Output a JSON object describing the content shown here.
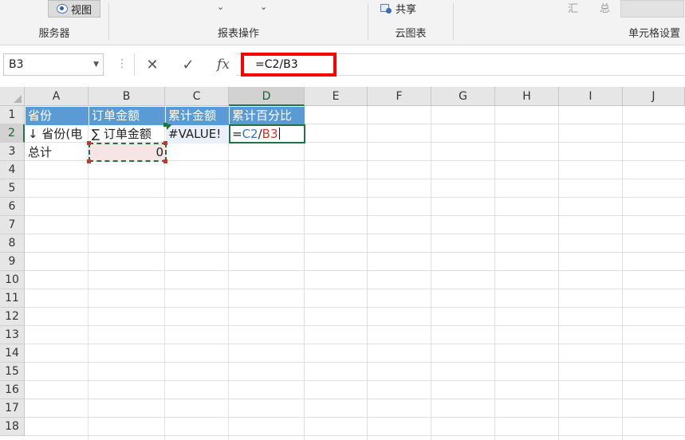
{
  "ribbon": {
    "view_button": "视图",
    "groups": [
      {
        "label": "服务器"
      },
      {
        "label": "报表操作"
      },
      {
        "label": "云图表"
      },
      {
        "label": "单元格设置"
      }
    ],
    "share_label": "共享",
    "sum_label": "汇",
    "total_label": "总"
  },
  "formula_bar": {
    "name_box": "B3",
    "cancel_icon": "✕",
    "enter_icon": "✓",
    "fx_label": "fx",
    "formula": "=C2/B3"
  },
  "grid": {
    "columns": [
      "A",
      "B",
      "C",
      "D",
      "E",
      "F",
      "G",
      "H",
      "I",
      "J"
    ],
    "rows": [
      "1",
      "2",
      "3",
      "4",
      "5",
      "6",
      "7",
      "8",
      "9",
      "10",
      "11",
      "12",
      "13",
      "14",
      "15",
      "16",
      "17",
      "18"
    ],
    "active_column": "D",
    "active_row": "2",
    "cells": {
      "A1": "省份",
      "B1": "订单金额",
      "C1": "累计金额",
      "D1": "累计百分比",
      "A2": "↓ 省份(电",
      "B2": "∑ 订单金额",
      "C2": "#VALUE!",
      "D2_eq": "=",
      "D2_ref1": "C2",
      "D2_op": "/",
      "D2_ref2": "B3",
      "A3": "总计",
      "B3": "0"
    },
    "colors": {
      "header_fill": "#5b9bd5",
      "selection": "#217346",
      "ref_c": "#3b6fc2",
      "ref_b": "#c0392b",
      "highlight": "#ff0000"
    }
  }
}
